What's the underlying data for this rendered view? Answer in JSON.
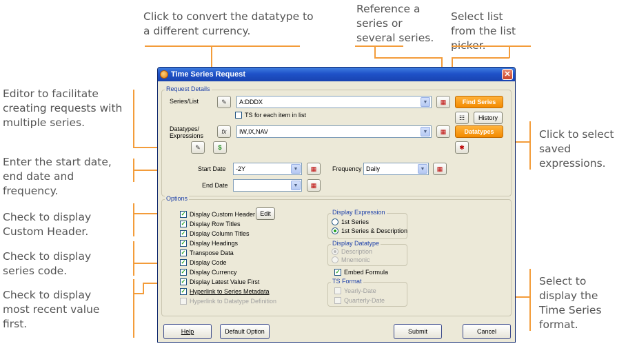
{
  "callouts": {
    "convert_currency": "Click to convert the datatype to a different currency.",
    "reference_series": "Reference a series or several series.",
    "select_list": "Select list from the list picker.",
    "editor_multiple": "Editor to facilitate creating requests with multiple series.",
    "saved_expressions": "Click to select saved expressions.",
    "start_end_date": "Enter the start date, end date and frequency.",
    "custom_header": "Check to display Custom Header.",
    "series_code": "Check to display series code.",
    "recent_value": "Check to display most recent value first.",
    "ts_format": "Select to display the Time Series format."
  },
  "dialog": {
    "title": "Time Series Request",
    "close": "✕",
    "request_details_label": "Request Details",
    "series_list_label": "Series/List",
    "series_value": "A:DDDX",
    "ts_each_item": "TS for each item in list",
    "find_series": "Find Series",
    "history": "History",
    "datatypes_label": "Datatypes/\nExpressions",
    "datatypes_value": "IW,IX,NAV",
    "datatypes_btn": "Datatypes",
    "fx": "fx",
    "currency": "$",
    "start_date_label": "Start Date",
    "start_date_value": "-2Y",
    "frequency_label": "Frequency",
    "frequency_value": "Daily",
    "end_date_label": "End Date",
    "end_date_value": "",
    "options_label": "Options",
    "edit_btn": "Edit",
    "checks": [
      "Display Custom Header",
      "Display Row Titles",
      "Display Column Titles",
      "Display Headings",
      "Transpose Data",
      "Display Code",
      "Display Currency",
      "Display Latest Value First",
      "Hyperlink to Series Metadata",
      "Hyperlink to Datatype Definition"
    ],
    "display_expression_label": "Display Expression",
    "expr_1st_series": "1st Series",
    "expr_1st_series_desc": "1st Series & Description",
    "display_datatype_label": "Display Datatype",
    "dt_description": "Description",
    "dt_mnemonic": "Mnemonic",
    "embed_formula": "Embed Formula",
    "ts_format_label": "TS Format",
    "yearly_date": "Yearly-Date",
    "quarterly_date": "Quarterly-Date",
    "help": "Help",
    "default_option": "Default Option",
    "submit": "Submit",
    "cancel": "Cancel"
  },
  "colors": {
    "accent_orange": "#f39c3a",
    "title_blue": "#1f52c8",
    "check_green": "#21a121"
  }
}
